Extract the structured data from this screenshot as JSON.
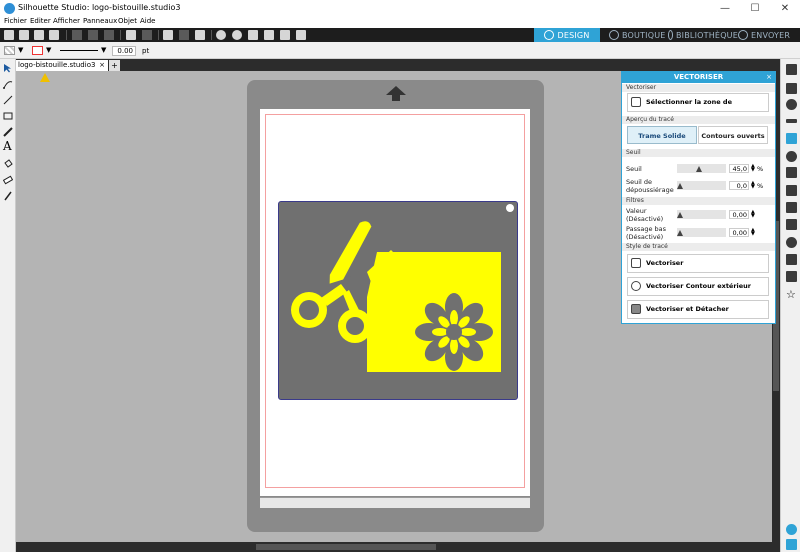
{
  "window": {
    "title": "Silhouette Studio: logo-bistouille.studio3",
    "minimize": "—",
    "maximize": "☐",
    "close": "✕"
  },
  "menu": [
    "Fichier",
    "Editer",
    "Afficher",
    "Panneaux",
    "Objet",
    "Aide"
  ],
  "nav_tabs": {
    "design": "DESIGN",
    "boutique": "BOUTIQUE",
    "bibliotheque": "BIBLIOTHÈQUE",
    "envoyer": "ENVOYER"
  },
  "properties": {
    "line_width": "0.00",
    "unit": "pt"
  },
  "document": {
    "tab_name": "logo-bistouille.studio3",
    "tab_close": "×",
    "add_tab": "+"
  },
  "panel": {
    "title": "VECTORISER",
    "close": "×",
    "sections": {
      "vectoriser": "Vectoriser",
      "apercu": "Aperçu du tracé",
      "seuil": "Seuil",
      "filtres": "Filtres",
      "style": "Style de tracé"
    },
    "select_area_button": "Sélectionner la zone de vectorisation",
    "preview_toggle": {
      "solid": "Trame Solide",
      "open": "Contours ouverts"
    },
    "seuil": {
      "label": "Seuil",
      "value": "45,0",
      "unit": "%",
      "level": 0.45
    },
    "deparasitage": {
      "label_line1": "Seuil de",
      "label_line2": "dépoussiérage",
      "value": "0,0",
      "unit": "%",
      "level": 0.0
    },
    "passe_haut": {
      "label_line1": "Valeur",
      "label_line2": "(Désactivé)",
      "value": "0,00",
      "level": 0.0
    },
    "passe_bas": {
      "label_line1": "Passage bas",
      "label_line2": "(Désactivé)",
      "value": "0,00",
      "level": 0.0
    },
    "actions": {
      "vectoriser": "Vectoriser",
      "contour": "Vectoriser Contour extérieur",
      "detacher": "Vectoriser et Détacher"
    },
    "spin_up": "▲",
    "spin_down": "▼"
  },
  "colors": {
    "accent": "#2fa3d6",
    "artwork_yellow": "#ffff00",
    "artwork_background": "#707070",
    "cut_line": "#f4a0a0"
  },
  "icons": {
    "warning": "warning-icon"
  }
}
